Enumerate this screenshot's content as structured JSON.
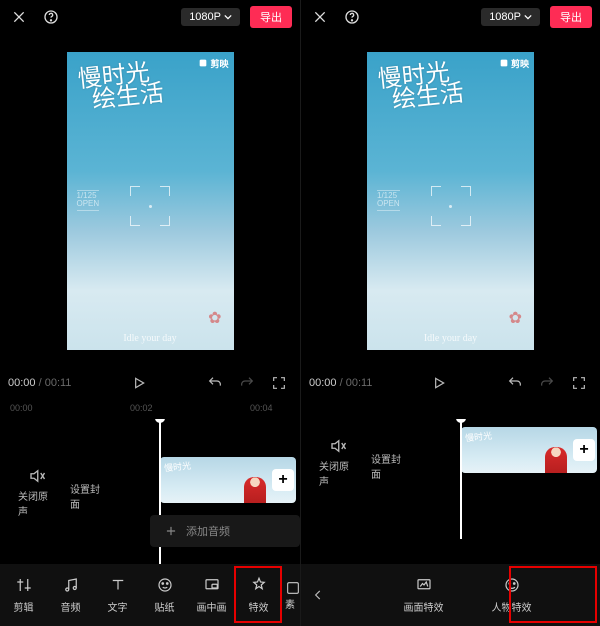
{
  "header": {
    "resolution": "1080P",
    "export": "导出"
  },
  "preview": {
    "watermark": "剪映",
    "script_line1": "慢时光",
    "script_line2": "绘生活",
    "exp_line1": "1/125",
    "exp_line2": "OPEN",
    "signature": "Idle your day"
  },
  "playbar": {
    "current": "00:00",
    "duration": "00:11"
  },
  "ruler": {
    "t0": "00:00",
    "t1": "00:02",
    "t2": "00:04"
  },
  "timeline": {
    "mute_label": "关闭原声",
    "cover_label": "设置封面",
    "add_audio": "添加音频"
  },
  "toolbar_left": {
    "edit": "剪辑",
    "audio": "音频",
    "text": "文字",
    "sticker": "贴纸",
    "pip": "画中画",
    "fx": "特效",
    "material_partial": "素"
  },
  "toolbar_right": {
    "screen_fx": "画面特效",
    "person_fx": "人物特效"
  }
}
